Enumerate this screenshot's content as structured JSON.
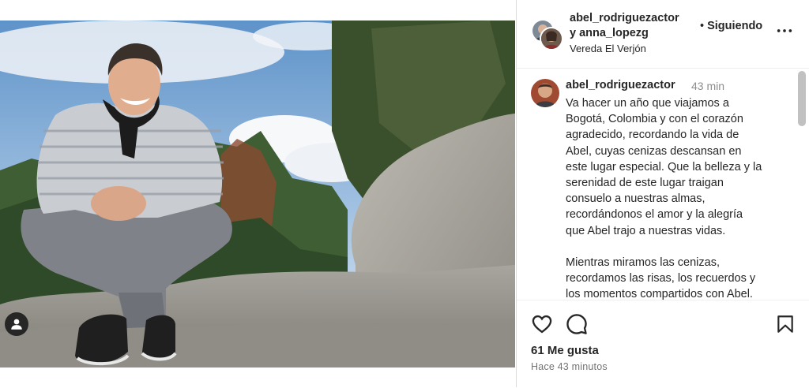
{
  "header": {
    "names_line1": "abel_rodriguezactor",
    "names_line2": "y anna_lopezg",
    "location": "Vereda El Verjón",
    "follow_status": "Siguiendo",
    "more_icon": "more-horizontal-icon"
  },
  "caption": {
    "username": "abel_rodriguezactor",
    "time_ago": "43 min",
    "text": "Va hacer un año que viajamos a\nBogotá, Colombia y con el corazón\nagradecido, recordando la vida de\nAbel, cuyas cenizas descansan en\neste lugar especial. Que la belleza y la\nserenidad de este lugar traigan\nconsuelo a nuestras almas,\nrecordándonos el amor y la alegría\nque Abel trajo a nuestras vidas.\n\nMientras miramos las cenizas,\nrecordamos las risas, los recuerdos y\nlos momentos compartidos con Abel."
  },
  "actions": {
    "like_icon": "heart-icon",
    "comment_icon": "comment-icon",
    "save_icon": "bookmark-icon",
    "likes": "61 Me gusta",
    "timestamp": "Hace 43 minutos"
  },
  "photo": {
    "tag_icon": "user-tag-icon"
  }
}
